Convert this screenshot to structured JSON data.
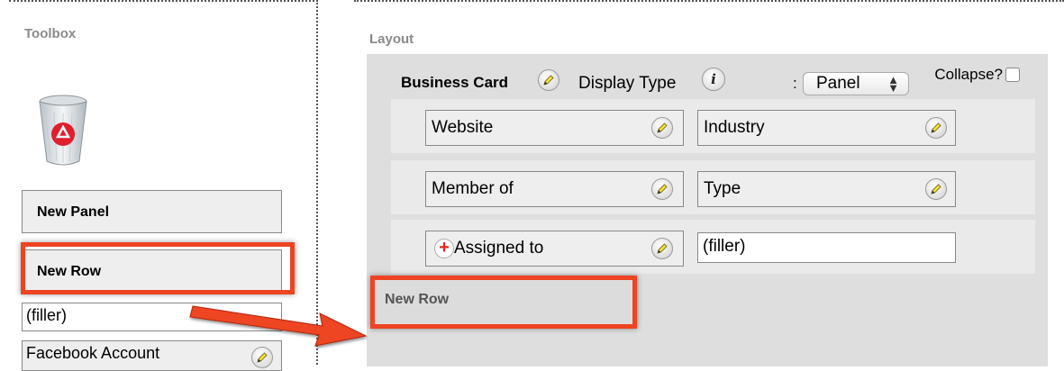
{
  "toolbox": {
    "title": "Toolbox",
    "items": [
      {
        "label": "New Panel"
      },
      {
        "label": "New Row"
      }
    ],
    "fields": [
      {
        "label": "(filler)"
      },
      {
        "label": "Facebook Account"
      }
    ]
  },
  "layout": {
    "title": "Layout",
    "panel": {
      "name": "Business Card",
      "display_type_label": "Display Type",
      "colon": ":",
      "display_type_value": "Panel",
      "collapse_label": "Collapse?",
      "collapse_checked": false
    },
    "rows": [
      {
        "left": "Website",
        "right": "Industry"
      },
      {
        "left": "Member of",
        "right": "Type"
      },
      {
        "left": "Assigned to",
        "right": "(filler)"
      }
    ],
    "dropped_row_label": "New Row"
  },
  "annotation": {
    "highlight_color": "#ee4422",
    "arrow_color": "#ee4422"
  },
  "icons": [
    "trash-icon",
    "pencil-icon",
    "info-icon",
    "plus-icon",
    "select-arrows-icon"
  ]
}
